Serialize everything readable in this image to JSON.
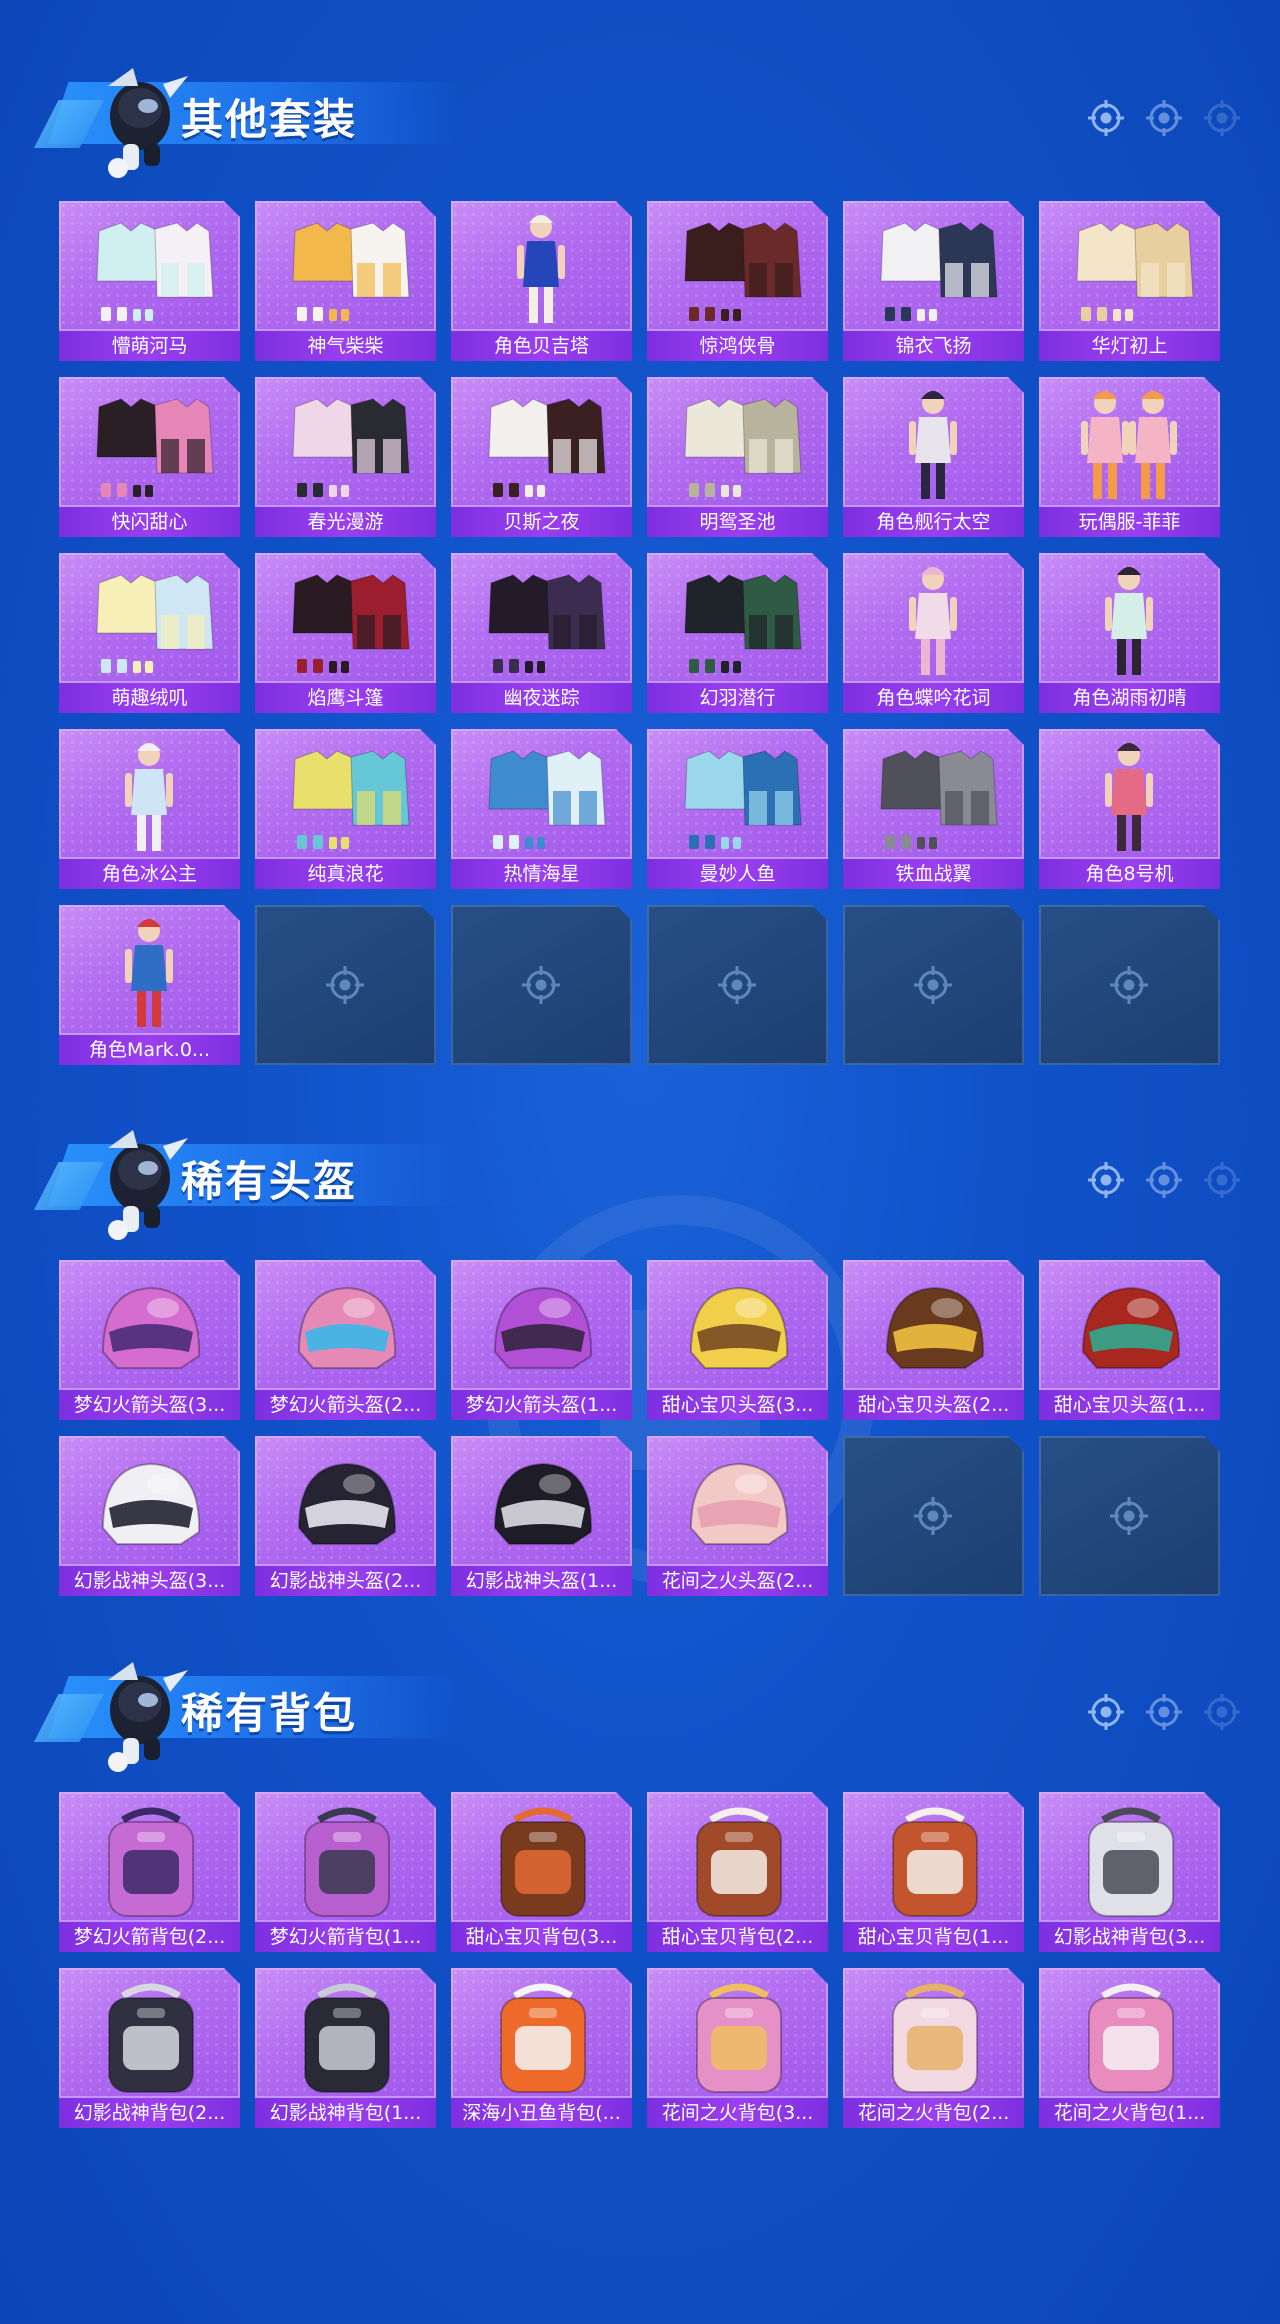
{
  "sections": [
    {
      "title": "其他套装",
      "items": [
        {
          "label": "懵萌河马",
          "art": "outfit",
          "c1": "#cfeff0",
          "c2": "#f4f0f6"
        },
        {
          "label": "神气柴柴",
          "art": "outfit",
          "c1": "#f2b84b",
          "c2": "#f7f4ef"
        },
        {
          "label": "角色贝吉塔",
          "art": "figure",
          "c1": "#2446b8",
          "c2": "#f3efe6"
        },
        {
          "label": "惊鸿侠骨",
          "art": "outfit",
          "c1": "#3a1d1d",
          "c2": "#6b2a2a"
        },
        {
          "label": "锦衣飞扬",
          "art": "outfit",
          "c1": "#f1f1f4",
          "c2": "#2c3657"
        },
        {
          "label": "华灯初上",
          "art": "outfit",
          "c1": "#f4e5c8",
          "c2": "#e8cfa0"
        },
        {
          "label": "快闪甜心",
          "art": "outfit",
          "c1": "#2a1f24",
          "c2": "#e686b8"
        },
        {
          "label": "春光漫游",
          "art": "outfit",
          "c1": "#f0d7e8",
          "c2": "#2a2a33"
        },
        {
          "label": "贝斯之夜",
          "art": "outfit",
          "c1": "#f3efef",
          "c2": "#3a2020"
        },
        {
          "label": "明鸳圣池",
          "art": "outfit",
          "c1": "#ece8d9",
          "c2": "#b8b39c"
        },
        {
          "label": "角色舰行太空",
          "art": "figure",
          "c1": "#e8e4ee",
          "c2": "#2a2540"
        },
        {
          "label": "玩偶服-菲菲",
          "art": "figure2",
          "c1": "#f4b4c6",
          "c2": "#f39b47"
        },
        {
          "label": "萌趣绒叽",
          "art": "outfit",
          "c1": "#f6efb7",
          "c2": "#cfe7f5"
        },
        {
          "label": "焰鹰斗篷",
          "art": "outfit",
          "c1": "#2a1b22",
          "c2": "#9b1e2e"
        },
        {
          "label": "幽夜迷踪",
          "art": "outfit",
          "c1": "#231b2a",
          "c2": "#3c2d50"
        },
        {
          "label": "幻羽潜行",
          "art": "outfit",
          "c1": "#1f232a",
          "c2": "#2f5a43"
        },
        {
          "label": "角色蝶吟花词",
          "art": "figure",
          "c1": "#f2dbe9",
          "c2": "#e9b7d2"
        },
        {
          "label": "角色湖雨初晴",
          "art": "figure",
          "c1": "#d5efe8",
          "c2": "#2a2530"
        },
        {
          "label": "角色冰公主",
          "art": "figure",
          "c1": "#cfe4f6",
          "c2": "#f0f0f6"
        },
        {
          "label": "纯真浪花",
          "art": "outfit",
          "c1": "#e8e06a",
          "c2": "#66c7d6"
        },
        {
          "label": "热情海星",
          "art": "outfit",
          "c1": "#3e8ccf",
          "c2": "#dff0f6"
        },
        {
          "label": "曼妙人鱼",
          "art": "outfit",
          "c1": "#9ad7ec",
          "c2": "#2b6fb5"
        },
        {
          "label": "铁血战翼",
          "art": "outfit",
          "c1": "#50505a",
          "c2": "#8a8a94"
        },
        {
          "label": "角色8号机",
          "art": "figure",
          "c1": "#e46a86",
          "c2": "#3a2a3a"
        },
        {
          "label": "角色Mark.0...",
          "art": "figure",
          "c1": "#2e6fc5",
          "c2": "#d13a3a"
        }
      ],
      "empty_count": 5
    },
    {
      "title": "稀有头盔",
      "items": [
        {
          "label": "梦幻火箭头盔(3...",
          "art": "helmet",
          "c1": "#d56ccf",
          "c2": "#4a2d7a"
        },
        {
          "label": "梦幻火箭头盔(2...",
          "art": "helmet",
          "c1": "#e58ab6",
          "c2": "#3ab7e8"
        },
        {
          "label": "梦幻火箭头盔(1...",
          "art": "helmet",
          "c1": "#b14fd6",
          "c2": "#352540"
        },
        {
          "label": "甜心宝贝头盔(3...",
          "art": "helmet",
          "c1": "#f2cf4a",
          "c2": "#7a4a25"
        },
        {
          "label": "甜心宝贝头盔(2...",
          "art": "helmet",
          "c1": "#6a3a1e",
          "c2": "#f0c040"
        },
        {
          "label": "甜心宝贝头盔(1...",
          "art": "helmet",
          "c1": "#a8281f",
          "c2": "#2fa88e"
        },
        {
          "label": "幻影战神头盔(3...",
          "art": "helmet",
          "c1": "#f0f0f4",
          "c2": "#232233"
        },
        {
          "label": "幻影战神头盔(2...",
          "art": "helmet",
          "c1": "#262433",
          "c2": "#e8e6ef"
        },
        {
          "label": "幻影战神头盔(1...",
          "art": "helmet",
          "c1": "#1e1c26",
          "c2": "#dcdce4"
        },
        {
          "label": "花间之火头盔(2...",
          "art": "helmet",
          "c1": "#f3c9c8",
          "c2": "#e7a0b0"
        }
      ],
      "empty_count": 2
    },
    {
      "title": "稀有背包",
      "items": [
        {
          "label": "梦幻火箭背包(2...",
          "art": "backpack",
          "c1": "#c76bd4",
          "c2": "#3b2a66"
        },
        {
          "label": "梦幻火箭背包(1...",
          "art": "backpack",
          "c1": "#b85fd0",
          "c2": "#383a50"
        },
        {
          "label": "甜心宝贝背包(3...",
          "art": "backpack",
          "c1": "#7a3a1e",
          "c2": "#e36a35"
        },
        {
          "label": "甜心宝贝背包(2...",
          "art": "backpack",
          "c1": "#a04a2a",
          "c2": "#f4efe8"
        },
        {
          "label": "甜心宝贝背包(1...",
          "art": "backpack",
          "c1": "#c2542e",
          "c2": "#f5f0ea"
        },
        {
          "label": "幻影战神背包(3...",
          "art": "backpack",
          "c1": "#e0e0e8",
          "c2": "#4a4a58"
        },
        {
          "label": "幻影战神背包(2...",
          "art": "backpack",
          "c1": "#303040",
          "c2": "#d8d8e2"
        },
        {
          "label": "幻影战神背包(1...",
          "art": "backpack",
          "c1": "#2a2a36",
          "c2": "#c9ccd6"
        },
        {
          "label": "深海小丑鱼背包(...",
          "art": "backpack",
          "c1": "#ee6a2a",
          "c2": "#f5f5f5"
        },
        {
          "label": "花间之火背包(3...",
          "art": "backpack",
          "c1": "#e690c8",
          "c2": "#f0c060"
        },
        {
          "label": "花间之火背包(2...",
          "art": "backpack",
          "c1": "#f2d8e0",
          "c2": "#e6b26a"
        },
        {
          "label": "花间之火背包(1...",
          "art": "backpack",
          "c1": "#e88cc0",
          "c2": "#f4f0f2"
        }
      ],
      "empty_count": 0
    }
  ],
  "colors": {
    "tile_purple": "#b16cf0",
    "label_bar": "#8a38e8",
    "empty_tile": "#224675",
    "background": "#1152c9"
  },
  "icons": {
    "header_deco": "crosshair-icon",
    "empty_slot": "crosshair-icon",
    "mascot": "mascot-icon"
  }
}
